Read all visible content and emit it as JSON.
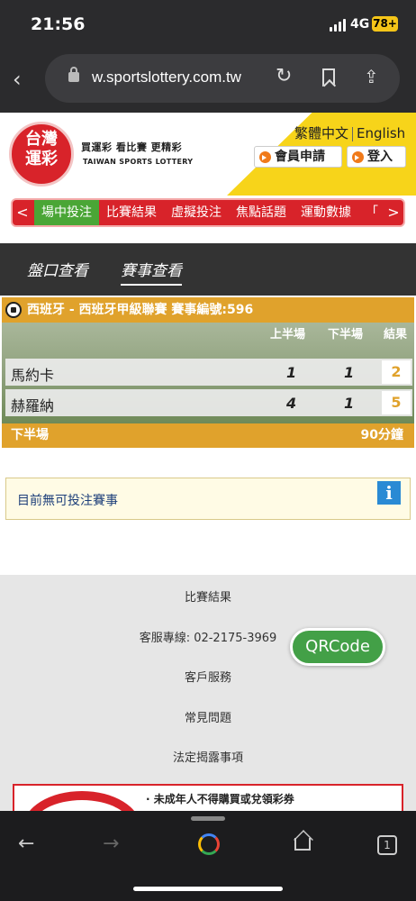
{
  "status": {
    "time": "21:56",
    "network": "4G",
    "battery": "78+"
  },
  "browser": {
    "url": "w.sportslottery.com.tw",
    "tab_count": "1"
  },
  "header": {
    "logo_line1": "台灣",
    "logo_line2": "運彩",
    "slogan": "買運彩 看比賽 更精彩",
    "slogan_en": "TAIWAN SPORTS LOTTERY",
    "lang_zh": "繁體中文",
    "lang_en": "English",
    "register": "會員申請",
    "login": "登入"
  },
  "nav": {
    "items": [
      "場中投注",
      "比賽結果",
      "虛擬投注",
      "焦點話題",
      "運動數據",
      "「"
    ],
    "active_index": 0
  },
  "tabs": {
    "tab1": "盤口查看",
    "tab2": "賽事查看",
    "active": "賽事查看"
  },
  "match": {
    "title": "西班牙 - 西班牙甲級聯賽 賽事編號:596",
    "col_first_half": "上半場",
    "col_second_half": "下半場",
    "col_result": "結果",
    "teams": [
      {
        "name": "馬約卡",
        "first_half": "1",
        "second_half": "1",
        "result": "2"
      },
      {
        "name": "赫羅納",
        "first_half": "4",
        "second_half": "1",
        "result": "5"
      }
    ],
    "period": "下半場",
    "minutes": "90分鐘"
  },
  "notice": {
    "text": "目前無可投注賽事"
  },
  "footer": {
    "links": [
      "比賽結果",
      "客服專線: 02-2175-3969",
      "客戶服務",
      "常見問題",
      "法定揭露事項"
    ],
    "qr_label": "QRCode",
    "warning": "· 未成年人不得購買或兌領彩券"
  }
}
